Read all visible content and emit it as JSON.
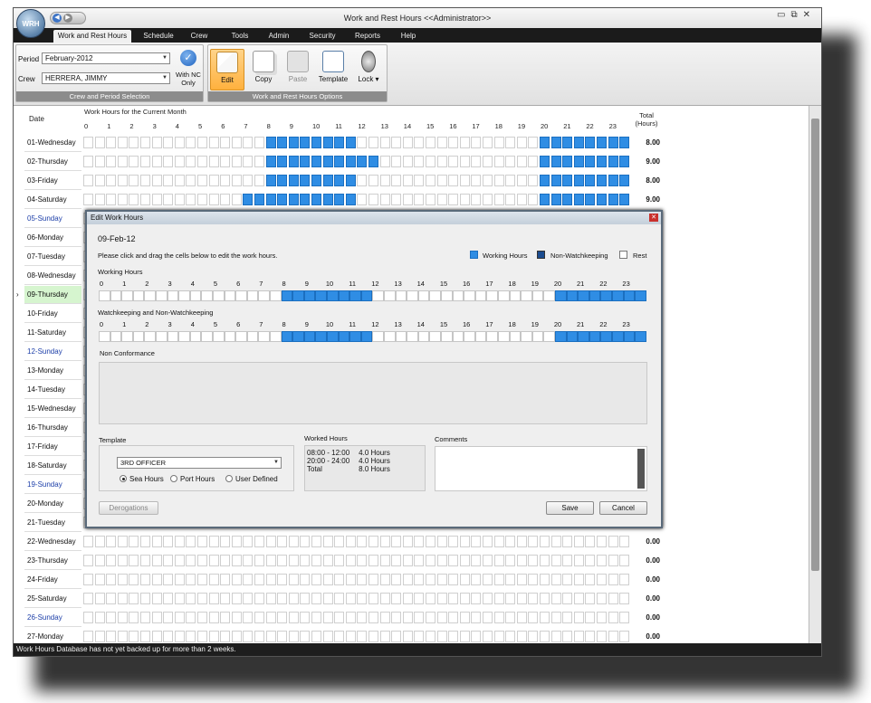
{
  "app": {
    "logo": "WRH",
    "title": "Work and Rest Hours <<Administrator>>",
    "window_buttons": [
      "minimize-icon",
      "restore-icon",
      "close-icon"
    ]
  },
  "menu": [
    "Work and Rest Hours",
    "Schedule",
    "Crew",
    "Tools",
    "Admin",
    "Security",
    "Reports",
    "Help"
  ],
  "ribbon": {
    "crew_period": {
      "period_label": "Period",
      "period_value": "February-2012",
      "crew_label": "Crew",
      "crew_value": "HERRERA, JIMMY",
      "with_nc_label": "With NC Only",
      "group_label": "Crew and Period Selection"
    },
    "options": {
      "buttons": [
        {
          "label": "Edit",
          "icon": "pencil-icon",
          "active": true
        },
        {
          "label": "Copy",
          "icon": "copy-icon"
        },
        {
          "label": "Paste",
          "icon": "paste-icon",
          "disabled": true
        },
        {
          "label": "Template",
          "icon": "template-icon"
        },
        {
          "label": "Lock",
          "icon": "lock-icon"
        }
      ],
      "group_label": "Work and Rest Hours Options"
    }
  },
  "grid": {
    "date_header": "Date",
    "hours_header": "Work Hours for the Current Month",
    "total_header_1": "Total",
    "total_header_2": "(Hours)",
    "hours": [
      "0",
      "1",
      "2",
      "3",
      "4",
      "5",
      "6",
      "7",
      "8",
      "9",
      "10",
      "11",
      "12",
      "13",
      "14",
      "15",
      "16",
      "17",
      "18",
      "19",
      "20",
      "21",
      "22",
      "23"
    ],
    "rows": [
      {
        "date": "01-Wednesday",
        "total": "8.00"
      },
      {
        "date": "02-Thursday",
        "total": "9.00"
      },
      {
        "date": "03-Friday",
        "total": "8.00"
      },
      {
        "date": "04-Saturday",
        "total": "9.00"
      },
      {
        "date": "05-Sunday",
        "total": ""
      },
      {
        "date": "06-Monday",
        "total": ""
      },
      {
        "date": "07-Tuesday",
        "total": ""
      },
      {
        "date": "08-Wednesday",
        "total": ""
      },
      {
        "date": "09-Thursday",
        "total": ""
      },
      {
        "date": "10-Friday",
        "total": ""
      },
      {
        "date": "11-Saturday",
        "total": ""
      },
      {
        "date": "12-Sunday",
        "total": ""
      },
      {
        "date": "13-Monday",
        "total": ""
      },
      {
        "date": "14-Tuesday",
        "total": ""
      },
      {
        "date": "15-Wednesday",
        "total": ""
      },
      {
        "date": "16-Thursday",
        "total": ""
      },
      {
        "date": "17-Friday",
        "total": ""
      },
      {
        "date": "18-Saturday",
        "total": ""
      },
      {
        "date": "19-Sunday",
        "total": ""
      },
      {
        "date": "20-Monday",
        "total": ""
      },
      {
        "date": "21-Tuesday",
        "total": ""
      },
      {
        "date": "22-Wednesday",
        "total": "0.00"
      },
      {
        "date": "23-Thursday",
        "total": "0.00"
      },
      {
        "date": "24-Friday",
        "total": "0.00"
      },
      {
        "date": "25-Saturday",
        "total": "0.00"
      },
      {
        "date": "26-Sunday",
        "total": "0.00"
      },
      {
        "date": "27-Monday",
        "total": "0.00"
      }
    ]
  },
  "dialog": {
    "title": "Edit Work Hours",
    "date": "09-Feb-12",
    "instruction": "Please click and drag the cells below to edit the work hours.",
    "legend": {
      "working": "Working Hours",
      "nonwatch": "Non-Watchkeeping",
      "rest": "Rest"
    },
    "working_label": "Working Hours",
    "watch_label": "Watchkeeping and Non-Watchkeeping",
    "nc_label": "Non Conformance",
    "template_label": "Template",
    "template_value": "3RD OFFICER",
    "radios": [
      "Sea Hours",
      "Port Hours",
      "User Defined"
    ],
    "worked_label": "Worked Hours",
    "worked_rows": [
      {
        "range": "08:00 - 12:00",
        "hours": "4.0 Hours"
      },
      {
        "range": "20:00 - 24:00",
        "hours": "4.0 Hours"
      },
      {
        "range": "Total",
        "hours": "8.0 Hours"
      }
    ],
    "comments_label": "Comments",
    "derogations": "Derogations",
    "save": "Save",
    "cancel": "Cancel"
  },
  "status": "Work Hours Database has not yet backed up for more than 2 weeks."
}
